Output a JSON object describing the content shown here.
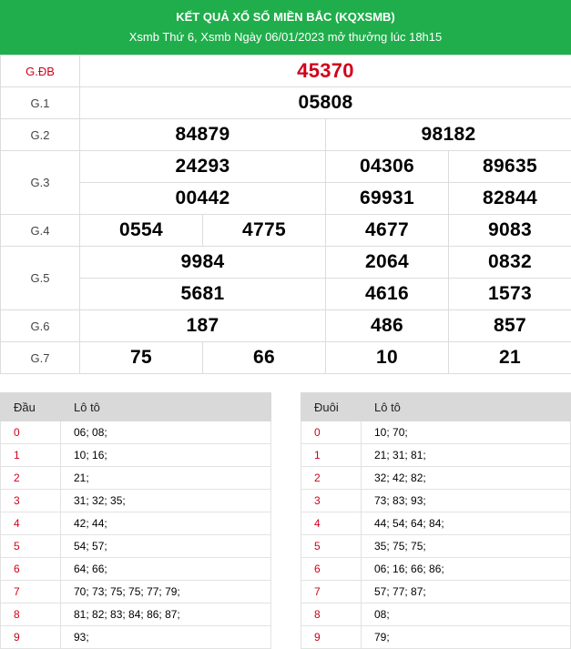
{
  "header": {
    "title": "KẾT QUẢ XỔ SỐ MIỀN BẮC (KQXSMB)",
    "subtitle": "Xsmb Thứ 6, Xsmb Ngày 06/01/2023 mở thưởng lúc 18h15"
  },
  "prizes": {
    "db": {
      "label": "G.ĐB",
      "numbers": [
        "45370"
      ]
    },
    "g1": {
      "label": "G.1",
      "numbers": [
        "05808"
      ]
    },
    "g2": {
      "label": "G.2",
      "numbers": [
        "84879",
        "98182"
      ]
    },
    "g3": {
      "label": "G.3",
      "numbers": [
        "24293",
        "04306",
        "89635",
        "00442",
        "69931",
        "82844"
      ]
    },
    "g4": {
      "label": "G.4",
      "numbers": [
        "0554",
        "4775",
        "4677",
        "9083"
      ]
    },
    "g5": {
      "label": "G.5",
      "numbers": [
        "9984",
        "2064",
        "0832",
        "5681",
        "4616",
        "1573"
      ]
    },
    "g6": {
      "label": "G.6",
      "numbers": [
        "187",
        "486",
        "857"
      ]
    },
    "g7": {
      "label": "G.7",
      "numbers": [
        "75",
        "66",
        "10",
        "21"
      ]
    }
  },
  "loto_dau": {
    "col1": "Đầu",
    "col2": "Lô tô",
    "rows": [
      {
        "key": "0",
        "values": "06; 08;"
      },
      {
        "key": "1",
        "values": "10; 16;"
      },
      {
        "key": "2",
        "values": "21;"
      },
      {
        "key": "3",
        "values": "31; 32; 35;"
      },
      {
        "key": "4",
        "values": "42; 44;"
      },
      {
        "key": "5",
        "values": "54; 57;"
      },
      {
        "key": "6",
        "values": "64; 66;"
      },
      {
        "key": "7",
        "values": "70; 73; 75; 75; 77; 79;"
      },
      {
        "key": "8",
        "values": "81; 82; 83; 84; 86; 87;"
      },
      {
        "key": "9",
        "values": "93;"
      }
    ]
  },
  "loto_duoi": {
    "col1": "Đuôi",
    "col2": "Lô tô",
    "rows": [
      {
        "key": "0",
        "values": "10; 70;"
      },
      {
        "key": "1",
        "values": "21; 31; 81;"
      },
      {
        "key": "2",
        "values": "32; 42; 82;"
      },
      {
        "key": "3",
        "values": "73; 83; 93;"
      },
      {
        "key": "4",
        "values": "44; 54; 64; 84;"
      },
      {
        "key": "5",
        "values": "35; 75; 75;"
      },
      {
        "key": "6",
        "values": "06; 16; 66; 86;"
      },
      {
        "key": "7",
        "values": "57; 77; 87;"
      },
      {
        "key": "8",
        "values": "08;"
      },
      {
        "key": "9",
        "values": "79;"
      }
    ]
  },
  "colors": {
    "header_bg": "#1fae4b",
    "special_red": "#d0021b",
    "table_head_bg": "#d9d9d9"
  }
}
